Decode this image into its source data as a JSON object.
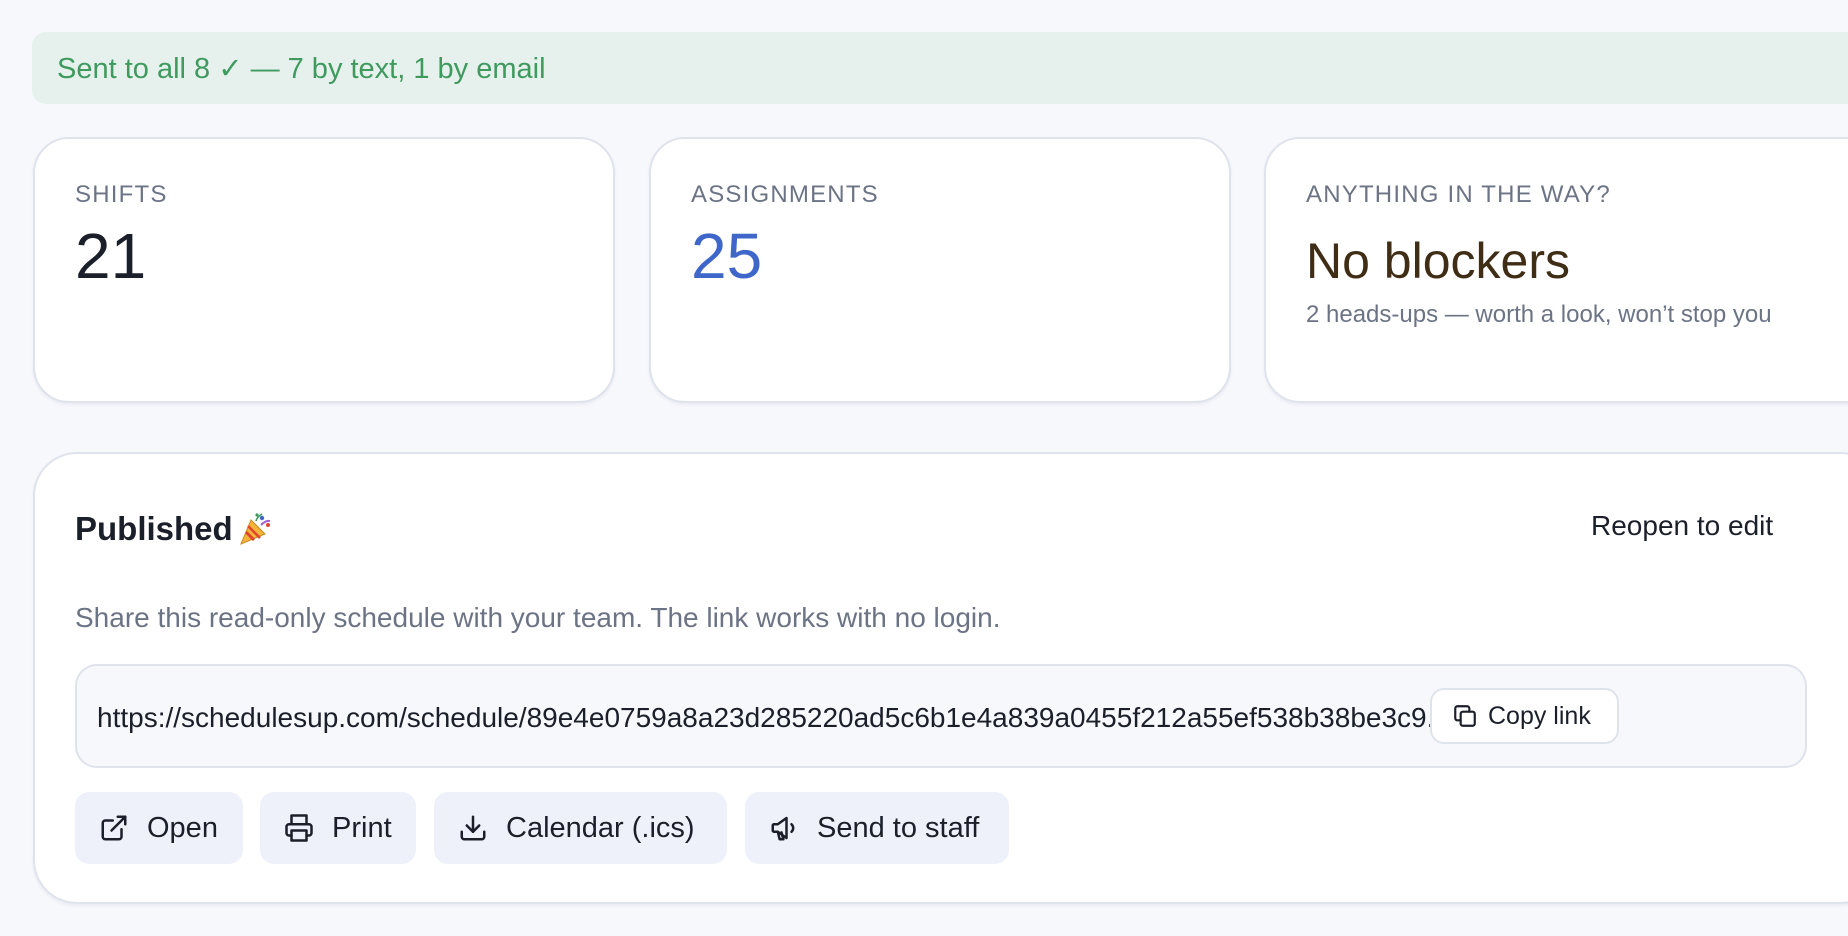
{
  "banner": {
    "text": "Sent to all 8 ✓ — 7 by text, 1 by email"
  },
  "stats": {
    "shifts": {
      "label": "SHIFTS",
      "value": "21"
    },
    "assignments": {
      "label": "ASSIGNMENTS",
      "value": "25"
    },
    "blockers": {
      "label": "ANYTHING IN THE WAY?",
      "value": "No blockers",
      "sub": "2 heads-ups — worth a look, won’t stop you"
    }
  },
  "publish": {
    "title": "Published",
    "reopen_label": "Reopen to edit",
    "share_text": "Share this read-only schedule with your team. The link works with no login.",
    "url": "https://schedulesup.com/schedule/89e4e0759a8a23d285220ad5c6b1e4a839a0455f212a55ef538b38be3c9...",
    "copy_label": "Copy link",
    "actions": {
      "open": "Open",
      "print": "Print",
      "calendar": "Calendar (.ics)",
      "send": "Send to staff"
    }
  },
  "colors": {
    "banner_bg": "#e6f1ee",
    "banner_text": "#3f9a5e",
    "assignments_value": "#3f66c9",
    "blockers_value": "#3f2d15",
    "action_bg": "#eef1f9"
  },
  "icons": {
    "party": "party-popper-icon",
    "copy": "copy-icon",
    "open": "external-link-icon",
    "print": "printer-icon",
    "calendar": "download-icon",
    "send": "megaphone-icon"
  }
}
